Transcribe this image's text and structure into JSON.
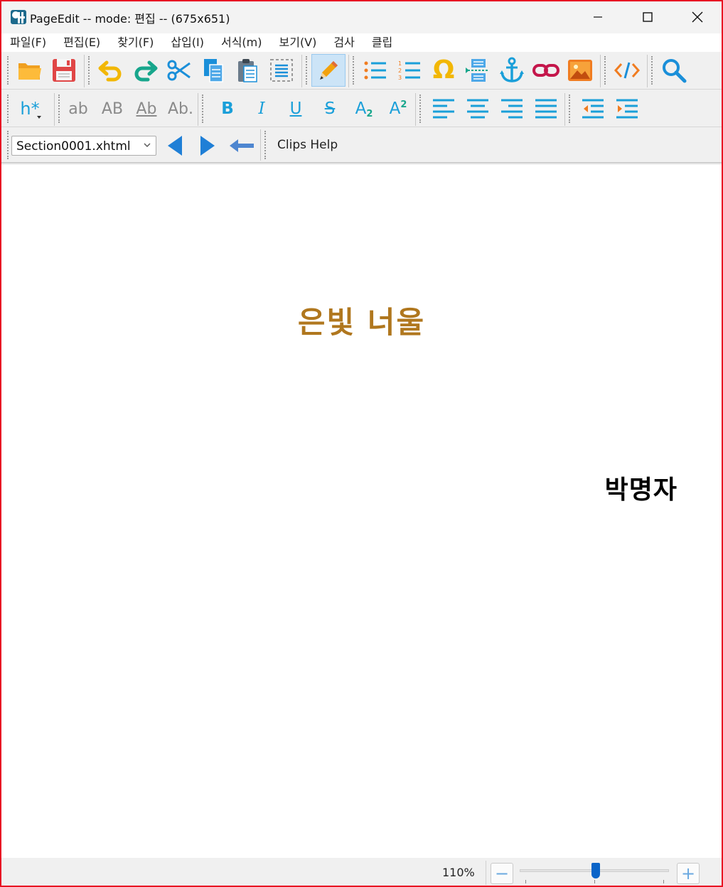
{
  "window": {
    "title": "PageEdit -- mode: 편집 -- (675x651)",
    "controls": {
      "minimize": "—",
      "maximize": "☐",
      "close": "✕"
    }
  },
  "menu": [
    "파일(F)",
    "편집(E)",
    "찾기(F)",
    "삽입(I)",
    "서식(m)",
    "보기(V)",
    "검사",
    "클립"
  ],
  "toolbar1": {
    "icons": [
      "open-folder-icon",
      "save-icon",
      "undo-icon",
      "redo-icon",
      "cut-icon",
      "copy-icon",
      "paste-icon",
      "select-all-icon",
      "edit-pencil-icon",
      "bullet-list-icon",
      "numbered-list-icon",
      "special-char-omega-icon",
      "split-section-icon",
      "anchor-icon",
      "link-icon",
      "image-icon",
      "code-icon",
      "search-icon"
    ],
    "omega_label": "Ω"
  },
  "toolbar2": {
    "heading_label": "h*",
    "case_buttons": [
      "ab",
      "AB",
      "Ab",
      "Ab."
    ],
    "format_buttons": {
      "bold": "B",
      "italic": "I",
      "underline": "U",
      "strike": "S",
      "subscript_base": "A",
      "subscript_mark": "2",
      "superscript_base": "A",
      "superscript_mark": "2"
    }
  },
  "toolbar3": {
    "file_select": "Section0001.xhtml",
    "clips_label": "Clips Help"
  },
  "document": {
    "title": "은빛 너울",
    "author": "박명자",
    "title_color": "#b0771e"
  },
  "status": {
    "zoom": "110%",
    "zoom_minus": "−",
    "zoom_plus": "+",
    "zoom_level": 0.5
  },
  "colors": {
    "accent": "#1a9fd9",
    "border": "#e81123"
  }
}
